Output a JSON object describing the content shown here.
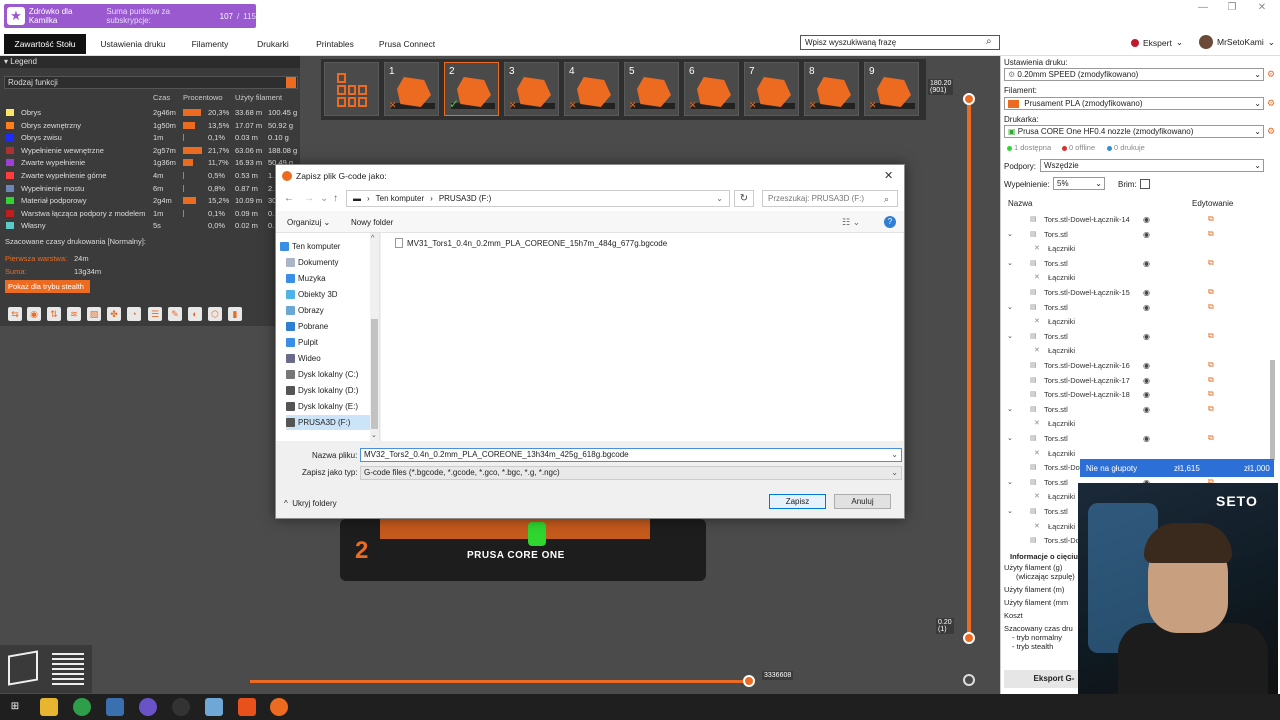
{
  "app": {
    "banner_text": "Zdrówko dla Kamilka",
    "banner_sub": "Suma punktów za subskrypcje:",
    "banner_value": "107",
    "banner_total": "115"
  },
  "tabs": [
    "Zawartość Stołu",
    "Ustawienia druku",
    "Filamenty",
    "Drukarki",
    "Printables",
    "Prusa Connect"
  ],
  "search_placeholder": "Wpisz wyszukiwaną frazę",
  "mode_label": "Ekspert",
  "user_name": "MrSetoKami",
  "legend": {
    "title": "Legend",
    "combo": "Rodzaj funkcji",
    "col_time": "Czas",
    "col_percent": "Procentowo",
    "col_filament": "Użyty filament",
    "rows": [
      {
        "name": "Obrys",
        "time": "2g46m",
        "pct": "20,3%",
        "m": "33.68 m",
        "g": "100.45 g",
        "color": "#ffe566",
        "frac": 0.203
      },
      {
        "name": "Obrys zewnętrzny",
        "time": "1g50m",
        "pct": "13,5%",
        "m": "17.07 m",
        "g": "50.92 g",
        "color": "#ff7f1f",
        "frac": 0.135
      },
      {
        "name": "Obrys zwisu",
        "time": "1m",
        "pct": "0,1%",
        "m": "0.03 m",
        "g": "0.10 g",
        "color": "#1e2bff",
        "frac": 0.001
      },
      {
        "name": "Wypełnienie wewnętrzne",
        "time": "2g57m",
        "pct": "21,7%",
        "m": "63.06 m",
        "g": "188.08 g",
        "color": "#b0302f",
        "frac": 0.217
      },
      {
        "name": "Zwarte wypełnienie",
        "time": "1g36m",
        "pct": "11,7%",
        "m": "16.93 m",
        "g": "50.49 g",
        "color": "#9b3fd6",
        "frac": 0.117
      },
      {
        "name": "Zwarte wypełnienie górne",
        "time": "4m",
        "pct": "0,5%",
        "m": "0.53 m",
        "g": "1.",
        "color": "#ff3d3d",
        "frac": 0.005
      },
      {
        "name": "Wypełnienie mostu",
        "time": "6m",
        "pct": "0,8%",
        "m": "0.87 m",
        "g": "2.",
        "color": "#6e86b8",
        "frac": 0.008
      },
      {
        "name": "Materiał podporowy",
        "time": "2g4m",
        "pct": "15,2%",
        "m": "10.09 m",
        "g": "30",
        "color": "#2fd62f",
        "frac": 0.152
      },
      {
        "name": "Warstwa łącząca podpory z modelem",
        "time": "1m",
        "pct": "0,1%",
        "m": "0.09 m",
        "g": "0.",
        "color": "#c21c1c",
        "frac": 0.001
      },
      {
        "name": "Własny",
        "time": "5s",
        "pct": "0,0%",
        "m": "0.02 m",
        "g": "0.",
        "color": "#5ec9c9",
        "frac": 0.0
      }
    ],
    "est_title": "Szacowane czasy drukowania [Normalny]:",
    "first_layer_label": "Pierwsza warstwa:",
    "first_layer_value": "24m",
    "total_label": "Suma:",
    "total_value": "13g34m",
    "stealth_button": "Pokaż dla trybu stealth"
  },
  "objects": [
    "1",
    "2",
    "3",
    "4",
    "5",
    "6",
    "7",
    "8",
    "9"
  ],
  "slider": {
    "top_label": "180.20",
    "top_sub": "(901)",
    "bottom_label": "0.20",
    "bottom_sub": "(1)",
    "h_label": "3336608"
  },
  "bed_brand": "PRUSA CORE ONE",
  "bed_number": "2",
  "right_panel": {
    "print_settings_label": "Ustawienia druku:",
    "print_settings_value": "0.20mm SPEED (zmodyfikowano)",
    "filament_label": "Filament:",
    "filament_value": "Prusament PLA (zmodyfikowano)",
    "printer_label": "Drukarka:",
    "printer_value": "Prusa CORE One HF0.4 nozzle (zmodyfikowano)",
    "status_available": "1 dostępna",
    "status_offline": "0 offline",
    "status_printing": "0 drukuje",
    "supports_label": "Podpory:",
    "supports_value": "Wszędzie",
    "infill_label": "Wypełnienie:",
    "infill_value": "5%",
    "brim_label": "Brim:",
    "col_name": "Nazwa",
    "col_edit": "Edytowanie",
    "items": [
      {
        "name": "Tors.stl-Dowel-Łącznik-14",
        "level": 1,
        "expand": "",
        "eye": true
      },
      {
        "name": "Tors.stl",
        "level": 0,
        "expand": "⌄",
        "eye": true
      },
      {
        "name": "Łączniki",
        "level": 2,
        "expand": "",
        "eye": false
      },
      {
        "name": "Tors.stl",
        "level": 0,
        "expand": "⌄",
        "eye": true
      },
      {
        "name": "Łączniki",
        "level": 2,
        "expand": "",
        "eye": false
      },
      {
        "name": "Tors.stl-Dowel-Łącznik-15",
        "level": 1,
        "expand": "",
        "eye": true
      },
      {
        "name": "Tors.stl",
        "level": 0,
        "expand": "⌄",
        "eye": true
      },
      {
        "name": "Łączniki",
        "level": 2,
        "expand": "",
        "eye": false
      },
      {
        "name": "Tors.stl",
        "level": 0,
        "expand": "⌄",
        "eye": true
      },
      {
        "name": "Łączniki",
        "level": 2,
        "expand": "",
        "eye": false
      },
      {
        "name": "Tors.stl-Dowel-Łącznik-16",
        "level": 1,
        "expand": "",
        "eye": true
      },
      {
        "name": "Tors.stl-Dowel-Łącznik-17",
        "level": 1,
        "expand": "",
        "eye": true
      },
      {
        "name": "Tors.stl-Dowel-Łącznik-18",
        "level": 1,
        "expand": "",
        "eye": true
      },
      {
        "name": "Tors.stl",
        "level": 0,
        "expand": "⌄",
        "eye": true
      },
      {
        "name": "Łączniki",
        "level": 2,
        "expand": "",
        "eye": false
      },
      {
        "name": "Tors.stl",
        "level": 0,
        "expand": "⌄",
        "eye": true
      },
      {
        "name": "Łączniki",
        "level": 2,
        "expand": "",
        "eye": false
      },
      {
        "name": "Tors.stl-Dowel",
        "level": 1,
        "expand": "",
        "eye": false
      },
      {
        "name": "Tors.stl",
        "level": 0,
        "expand": "⌄",
        "eye": true
      },
      {
        "name": "Łączniki",
        "level": 2,
        "expand": "",
        "eye": false
      },
      {
        "name": "Tors.stl",
        "level": 0,
        "expand": "⌄",
        "eye": true
      },
      {
        "name": "Łączniki",
        "level": 2,
        "expand": "",
        "eye": false
      },
      {
        "name": "Tors.stl-Dowe",
        "level": 1,
        "expand": "",
        "eye": false
      }
    ],
    "info_title": "Informacje o cięciu",
    "info_lines": [
      "Użyty filament (g)",
      "(wliczając szpulę)",
      "Użyty filament (m)",
      "Użyty filament (mm",
      "Koszt",
      "Szacowany czas dru",
      "- tryb normalny",
      "- tryb stealth"
    ],
    "export_button": "Eksport G-"
  },
  "overlay": {
    "text": "Nie na głupoty",
    "v1": "zł1,615",
    "v2": "zł1,000"
  },
  "webcam_logo": "SETO",
  "dialog": {
    "title": "Zapisz plik G-code jako:",
    "path_root": "Ten komputer",
    "path_leaf": "PRUSA3D (F:)",
    "search_placeholder": "Przeszukaj: PRUSA3D (F:)",
    "organize": "Organizuj",
    "new_folder": "Nowy folder",
    "tree": [
      {
        "label": "Ten komputer",
        "color": "#3a8ee6",
        "sel": false
      },
      {
        "label": "Dokumenty",
        "color": "#aab5c5",
        "sel": false
      },
      {
        "label": "Muzyka",
        "color": "#3a8ee6",
        "sel": false
      },
      {
        "label": "Obiekty 3D",
        "color": "#4fb3e8",
        "sel": false
      },
      {
        "label": "Obrazy",
        "color": "#6ca8d6",
        "sel": false
      },
      {
        "label": "Pobrane",
        "color": "#2e7fd1",
        "sel": false
      },
      {
        "label": "Pulpit",
        "color": "#3a8ee6",
        "sel": false
      },
      {
        "label": "Wideo",
        "color": "#6a6a8a",
        "sel": false
      },
      {
        "label": "Dysk lokalny (C:)",
        "color": "#777",
        "sel": false
      },
      {
        "label": "Dysk lokalny (D:)",
        "color": "#555",
        "sel": false
      },
      {
        "label": "Dysk lokalny (E:)",
        "color": "#555",
        "sel": false
      },
      {
        "label": "PRUSA3D (F:)",
        "color": "#555",
        "sel": true
      }
    ],
    "file": "MV31_Tors1_0.4n_0.2mm_PLA_COREONE_15h7m_484g_677g.bgcode",
    "filename_label": "Nazwa pliku:",
    "filename_value": "MV32_Tors2_0.4n_0.2mm_PLA_COREONE_13h34m_425g_618g.bgcode",
    "filetype_label": "Zapisz jako typ:",
    "filetype_value": "G-code files (*.bgcode, *.gcode, *.gco, *.bgc, *.g, *.ngc)",
    "hide_folders": "Ukryj foldery",
    "save": "Zapisz",
    "cancel": "Anuluj"
  }
}
